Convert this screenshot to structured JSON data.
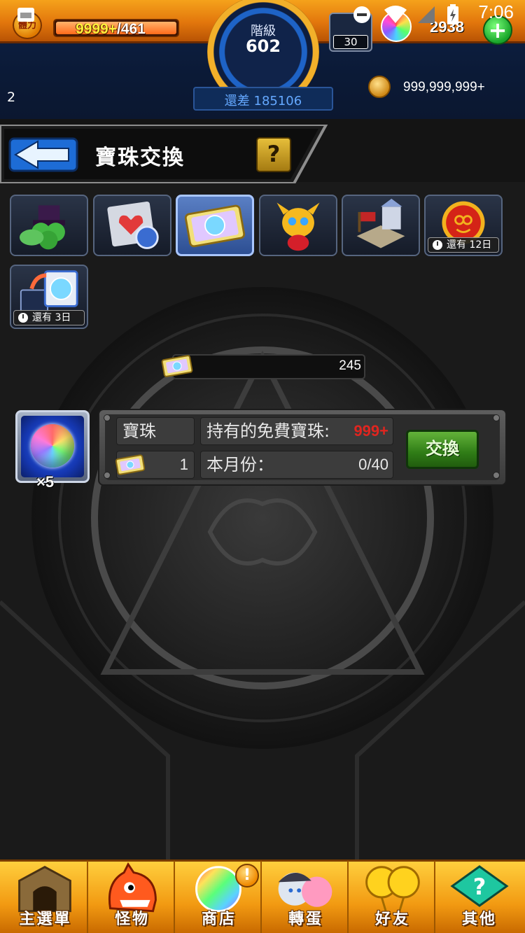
{
  "status_bar": {
    "time": "7:06"
  },
  "header": {
    "stamina_badge": "體力",
    "stamina_current": "9999+",
    "stamina_max": "/461",
    "stamina_fill": 1.0,
    "rank_label": "階級",
    "rank_value": "602",
    "rank_remaining": "還差 185106",
    "orb_box_count": "30",
    "orb_count": "2938",
    "add_orb_label": "+",
    "left_number": "2",
    "gold_amount": "999,999,999+"
  },
  "title_bar": {
    "title": "寶珠交換",
    "help_label": "?"
  },
  "tabs": [
    {
      "name": "clover-hat-tab",
      "icon": "clover-hat-icon",
      "active": false
    },
    {
      "name": "heart-card-tab",
      "icon": "heart-card-icon",
      "active": false
    },
    {
      "name": "orb-ticket-tab",
      "icon": "orb-ticket-icon",
      "active": true
    },
    {
      "name": "dragon-mascot-tab",
      "icon": "dragon-mascot-icon",
      "active": false
    },
    {
      "name": "castle-tab",
      "icon": "castle-icon",
      "active": false
    },
    {
      "name": "medal-tab",
      "icon": "medal-icon",
      "active": false,
      "timer": "還有 12日"
    },
    {
      "name": "orb-exchange-card-tab",
      "icon": "orb-exchange-card-icon",
      "active": false,
      "timer": "還有 3日"
    }
  ],
  "currency": {
    "ticket_count": "245"
  },
  "exchange_item": {
    "reward_qty": "×5",
    "item_name": "寶珠",
    "free_orbs_label": "持有的免費寶珠:",
    "free_orbs_value": "999+",
    "cost_value": "1",
    "monthly_label": "本月份：",
    "monthly_value": "0/40",
    "exchange_button": "交換"
  },
  "bottom_nav": [
    {
      "label": "主選單",
      "icon": "gate-icon"
    },
    {
      "label": "怪物",
      "icon": "monster-icon"
    },
    {
      "label": "商店",
      "icon": "rainbow-orb-icon",
      "alert": "!"
    },
    {
      "label": "轉蛋",
      "icon": "gacha-characters-icon"
    },
    {
      "label": "好友",
      "icon": "friends-balloon-icon"
    },
    {
      "label": "其他",
      "icon": "question-signpost-icon"
    }
  ],
  "colors": {
    "accent_orange": "#f29a12",
    "header_navy": "#0f2347",
    "active_tab": "#5a7fc4",
    "exchange_green": "#2f7c16",
    "alert_red": "#e0251f",
    "rank_blue": "#64a8ff"
  }
}
